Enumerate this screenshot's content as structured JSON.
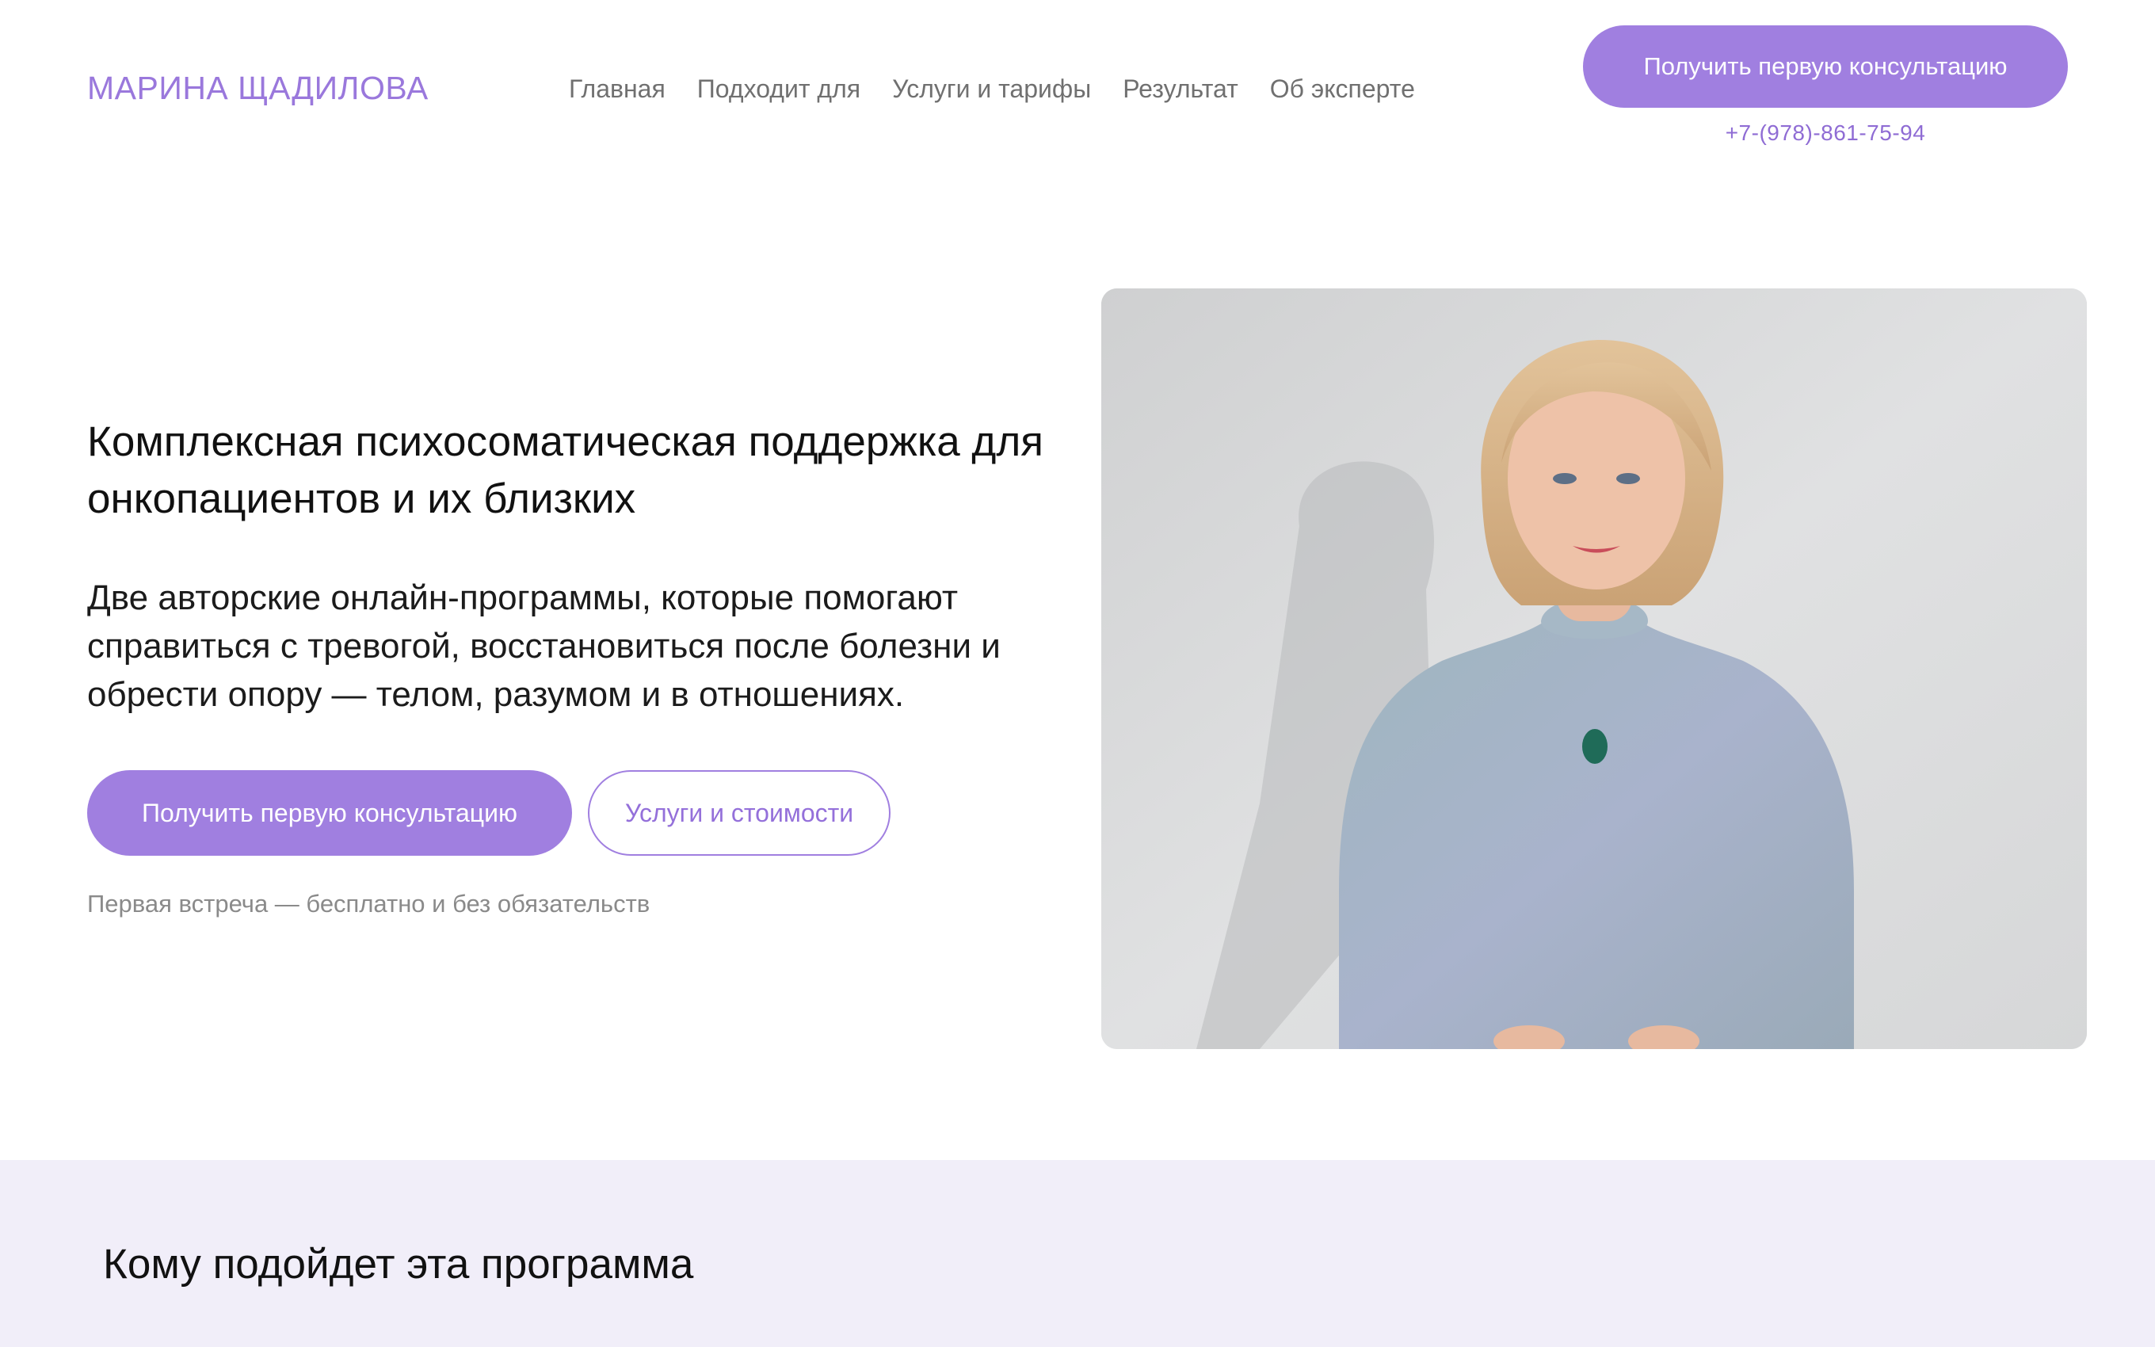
{
  "header": {
    "logo": "МАРИНА ЩАДИЛОВА",
    "nav": [
      {
        "label": "Главная"
      },
      {
        "label": "Подходит для"
      },
      {
        "label": "Услуги и тарифы"
      },
      {
        "label": "Результат"
      },
      {
        "label": "Об эксперте"
      }
    ],
    "cta_label": "Получить первую консультацию",
    "phone": "+7-(978)-861-75-94"
  },
  "hero": {
    "title": "Комплексная психосоматическая поддержка для онкопациентов и их близких",
    "subtitle": "Две авторские онлайн-программы, которые помогают справиться с тревогой, восстановиться после болезни и обрести опору — телом, разумом и в отношениях.",
    "primary_button": "Получить первую консультацию",
    "secondary_button": "Услуги и стоимости",
    "note": "Первая встреча — бесплатно и без обязательств"
  },
  "audience": {
    "title": "Кому подойдет эта программа"
  },
  "colors": {
    "accent": "#a07fe0",
    "accent_text": "#9470da",
    "section_bg": "#f1eef9"
  }
}
